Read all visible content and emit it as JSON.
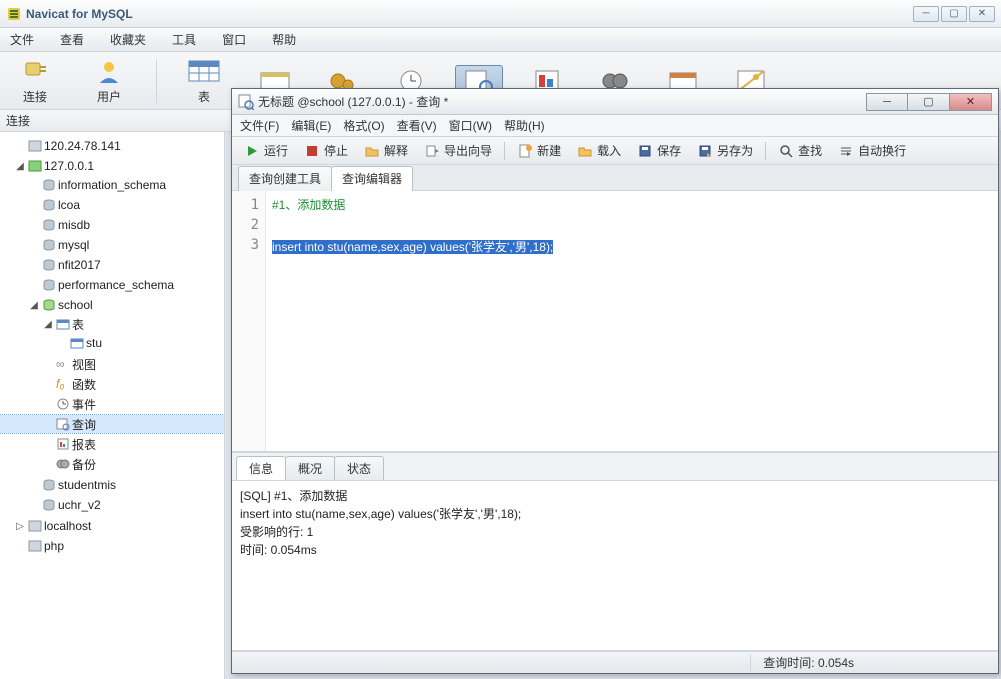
{
  "app": {
    "title": "Navicat for MySQL"
  },
  "mainMenu": [
    "文件",
    "查看",
    "收藏夹",
    "工具",
    "窗口",
    "帮助"
  ],
  "bigTools": {
    "connect": "连接",
    "user": "用户",
    "table": "表"
  },
  "connHeader": "连接",
  "tree": {
    "host1": "120.24.78.141",
    "host2": "127.0.0.1",
    "dbs": {
      "information_schema": "information_schema",
      "lcoa": "lcoa",
      "misdb": "misdb",
      "mysql": "mysql",
      "nfit2017": "nfit2017",
      "performance_schema": "performance_schema",
      "school": "school",
      "studentmis": "studentmis",
      "uchr_v2": "uchr_v2"
    },
    "schoolChildren": {
      "tables": "表",
      "stu": "stu",
      "views": "视图",
      "functions": "函数",
      "events": "事件",
      "queries": "查询",
      "reports": "报表",
      "backups": "备份"
    },
    "localhost": "localhost",
    "php": "php"
  },
  "editor": {
    "title": "无标题 @school (127.0.0.1) - 查询 *",
    "menu": {
      "file": "文件(F)",
      "edit": "编辑(E)",
      "format": "格式(O)",
      "view": "查看(V)",
      "window": "窗口(W)",
      "help": "帮助(H)"
    },
    "toolbar": {
      "run": "运行",
      "stop": "停止",
      "explain": "解释",
      "exportWizard": "导出向导",
      "new": "新建",
      "load": "载入",
      "save": "保存",
      "saveAs": "另存为",
      "find": "查找",
      "autoWrap": "自动换行"
    },
    "tabs": {
      "builder": "查询创建工具",
      "editor": "查询编辑器"
    },
    "lines": {
      "l1": "#1、添加数据",
      "l2": "",
      "l3": "insert into stu(name,sex,age) values('张学友','男',18);"
    },
    "resultTabs": {
      "info": "信息",
      "profile": "概况",
      "status": "状态"
    },
    "result": {
      "l1": "[SQL] #1、添加数据",
      "l2": "",
      "l3": "insert into stu(name,sex,age) values('张学友','男',18);",
      "l4": "受影响的行: 1",
      "l5": "时间: 0.054ms"
    },
    "status": "查询时间: 0.054s"
  }
}
